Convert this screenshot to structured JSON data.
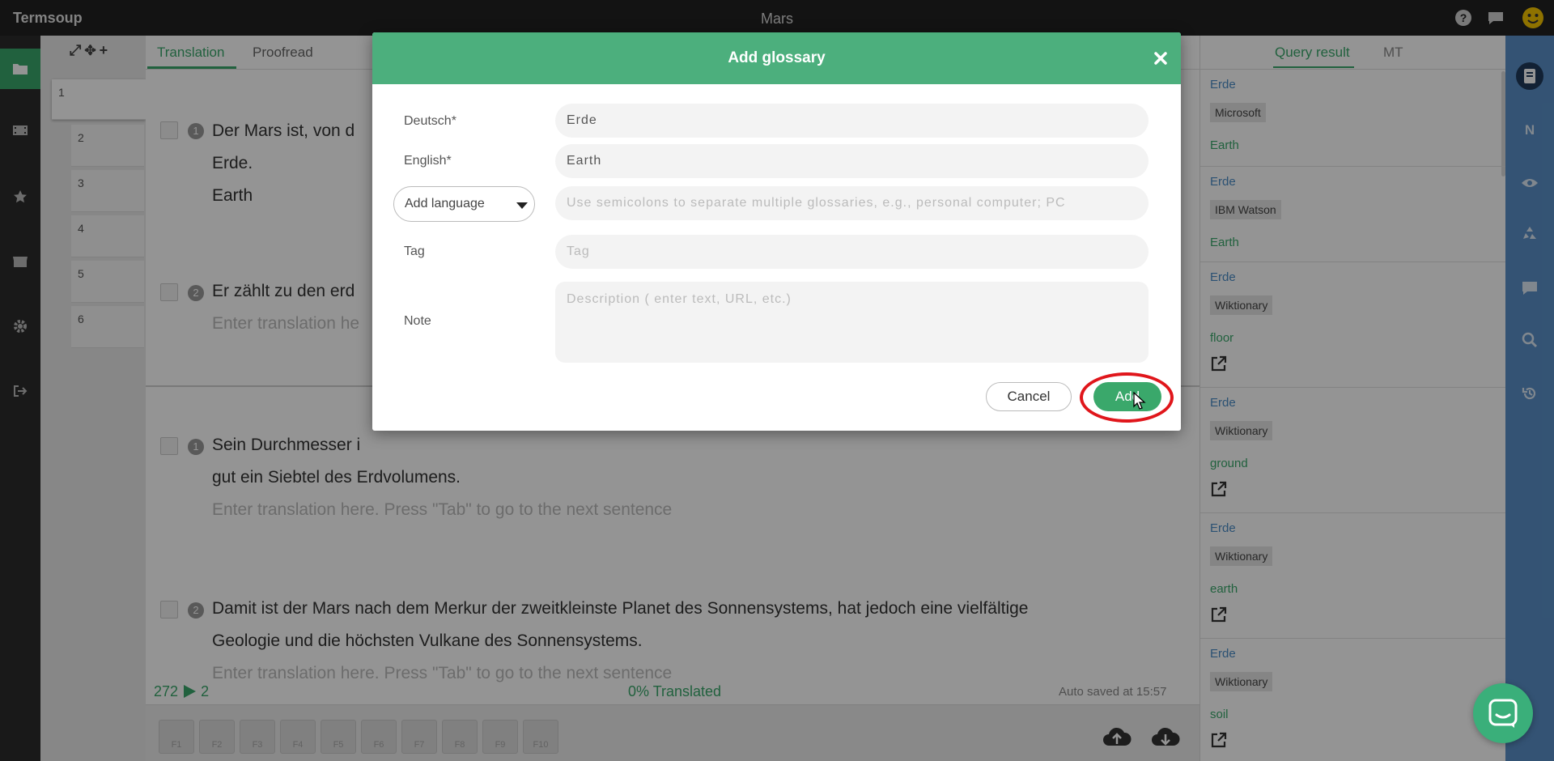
{
  "app": {
    "brand": "Termsoup",
    "document_title": "Mars"
  },
  "segment_tools": "⤢✥+",
  "segment_numbers": [
    "1",
    "2",
    "3",
    "4",
    "5",
    "6"
  ],
  "editor": {
    "tabs": [
      "Translation",
      "Proofread"
    ],
    "segments": [
      {
        "id": "1",
        "source_line1": "Der Mars ist, von d",
        "source_line2": "Erde.",
        "target": "Earth"
      },
      {
        "id": "2",
        "source": "Er zählt zu den erd",
        "placeholder": "Enter translation he"
      },
      {
        "id": "1",
        "source_line1": "Sein Durchmesser i",
        "source_line2": "gut ein Siebtel des Erdvolumens.",
        "placeholder": "Enter translation here. Press \"Tab\" to go to the next sentence"
      },
      {
        "id": "2",
        "source_line1": "Damit ist der Mars nach dem Merkur der zweitkleinste Planet des Sonnensystems, hat jedoch eine vielfältige",
        "source_line2": "Geologie und die höchsten Vulkane des Sonnensystems.",
        "placeholder": "Enter translation here. Press \"Tab\" to go to the next sentence"
      }
    ],
    "status": {
      "count_left": "272",
      "count_right": "2",
      "translated": "0% Translated",
      "autosaved": "Auto saved at 15:57"
    },
    "fkeys": [
      "F1",
      "F2",
      "F3",
      "F4",
      "F5",
      "F6",
      "F7",
      "F8",
      "F9",
      "F10"
    ]
  },
  "right_panel": {
    "tabs": [
      "Query result",
      "MT"
    ],
    "results": [
      {
        "term": "Erde",
        "source": "Microsoft",
        "translation": "Earth",
        "link": false
      },
      {
        "term": "Erde",
        "source": "IBM Watson",
        "translation": "Earth",
        "link": false
      },
      {
        "term": "Erde",
        "source": "Wiktionary",
        "translation": "floor",
        "link": true
      },
      {
        "term": "Erde",
        "source": "Wiktionary",
        "translation": "ground",
        "link": true
      },
      {
        "term": "Erde",
        "source": "Wiktionary",
        "translation": "earth",
        "link": true
      },
      {
        "term": "Erde",
        "source": "Wiktionary",
        "translation": "soil",
        "link": true
      }
    ]
  },
  "modal": {
    "title": "Add glossary",
    "fields": {
      "deutsch_label": "Deutsch*",
      "deutsch_value": "Erde",
      "english_label": "English*",
      "english_value": "Earth",
      "add_language_label": "Add language",
      "more_placeholder": "Use semicolons to separate multiple glossaries, e.g., personal computer; PC",
      "tag_label": "Tag",
      "tag_placeholder": "Tag",
      "note_label": "Note",
      "note_placeholder": "Description ( enter text, URL, etc.)"
    },
    "cancel_label": "Cancel",
    "add_label": "Add"
  },
  "colors": {
    "accent": "#3aa86b",
    "header_green": "#4caf7d",
    "blue_toolbar": "#5a90c8",
    "highlight_ring": "#e0161b"
  }
}
